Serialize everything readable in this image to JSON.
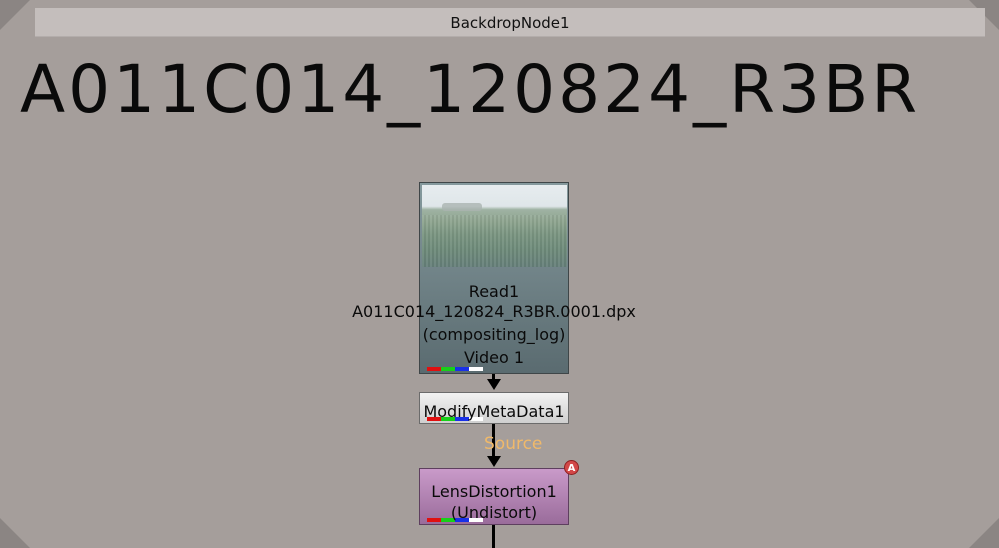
{
  "backdrop": {
    "title": "BackdropNode1",
    "label": "A011C014_120824_R3BR"
  },
  "nodes": {
    "read": {
      "name": "Read1",
      "file": "A011C014_120824_R3BR.0001.dpx",
      "colorspace": "(compositing_log)",
      "view": "Video 1"
    },
    "modify": {
      "name": "ModifyMetaData1"
    },
    "lens": {
      "name": "LensDistortion1",
      "mode": "(Undistort)",
      "input_badge": "A"
    }
  },
  "pipes": {
    "input_label": "Source"
  },
  "colors": {
    "background": "#a59e9b",
    "read_node": "#7a8d91",
    "modify_node": "#e0e0e0",
    "lens_node": "#b483b5",
    "source_label": "#f0b96a",
    "badge": "#d24848"
  }
}
